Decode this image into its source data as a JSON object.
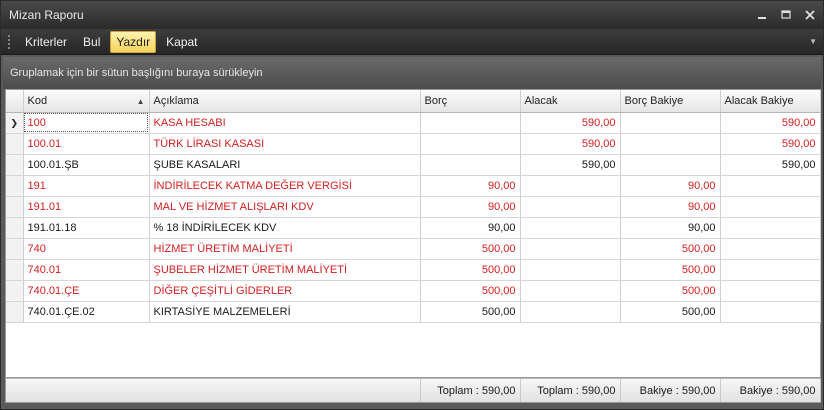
{
  "window": {
    "title": "Mizan Raporu"
  },
  "toolbar": {
    "items": [
      "Kriterler",
      "Bul",
      "Yazdır",
      "Kapat"
    ],
    "active": "Yazdır"
  },
  "group_panel": {
    "text": "Gruplamak için bir sütun başlığını buraya sürükleyin"
  },
  "columns": [
    "Kod",
    "Açıklama",
    "Borç",
    "Alacak",
    "Borç Bakiye",
    "Alacak Bakiye"
  ],
  "rows": [
    {
      "kod": "100",
      "aciklama": "KASA HESABI",
      "borc": "",
      "alacak": "590,00",
      "borc_bakiye": "",
      "alacak_bakiye": "590,00",
      "highlight": true
    },
    {
      "kod": "100.01",
      "aciklama": "TÜRK LİRASI KASASI",
      "borc": "",
      "alacak": "590,00",
      "borc_bakiye": "",
      "alacak_bakiye": "590,00",
      "highlight": true
    },
    {
      "kod": "100.01.ŞB",
      "aciklama": "ŞUBE KASALARI",
      "borc": "",
      "alacak": "590,00",
      "borc_bakiye": "",
      "alacak_bakiye": "590,00",
      "highlight": false
    },
    {
      "kod": "191",
      "aciklama": "İNDİRİLECEK KATMA DEĞER VERGİSİ",
      "borc": "90,00",
      "alacak": "",
      "borc_bakiye": "90,00",
      "alacak_bakiye": "",
      "highlight": true
    },
    {
      "kod": "191.01",
      "aciklama": "MAL VE HİZMET ALIŞLARI KDV",
      "borc": "90,00",
      "alacak": "",
      "borc_bakiye": "90,00",
      "alacak_bakiye": "",
      "highlight": true
    },
    {
      "kod": "191.01.18",
      "aciklama": "% 18 İNDİRİLECEK KDV",
      "borc": "90,00",
      "alacak": "",
      "borc_bakiye": "90,00",
      "alacak_bakiye": "",
      "highlight": false
    },
    {
      "kod": "740",
      "aciklama": "HİZMET ÜRETİM MALİYETİ",
      "borc": "500,00",
      "alacak": "",
      "borc_bakiye": "500,00",
      "alacak_bakiye": "",
      "highlight": true
    },
    {
      "kod": "740.01",
      "aciklama": "ŞUBELER HİZMET ÜRETİM MALİYETİ",
      "borc": "500,00",
      "alacak": "",
      "borc_bakiye": "500,00",
      "alacak_bakiye": "",
      "highlight": true
    },
    {
      "kod": "740.01.ÇE",
      "aciklama": "DİĞER ÇEŞİTLİ GİDERLER",
      "borc": "500,00",
      "alacak": "",
      "borc_bakiye": "500,00",
      "alacak_bakiye": "",
      "highlight": true
    },
    {
      "kod": "740.01.ÇE.02",
      "aciklama": "KIRTASİYE MALZEMELERİ",
      "borc": "500,00",
      "alacak": "",
      "borc_bakiye": "500,00",
      "alacak_bakiye": "",
      "highlight": false
    }
  ],
  "footer": {
    "borc_total": "Toplam : 590,00",
    "alacak_total": "Toplam : 590,00",
    "borc_bakiye_total": "Bakiye : 590,00",
    "alacak_bakiye_total": "Bakiye : 590,00"
  },
  "colors": {
    "highlight_text": "#d21f1f",
    "active_button": "#f6d25a"
  },
  "icons": [
    "minimize-icon",
    "maximize-icon",
    "close-icon",
    "toolbar-grip-icon",
    "toolbar-overflow-icon",
    "sort-ascending-icon",
    "current-row-icon"
  ]
}
